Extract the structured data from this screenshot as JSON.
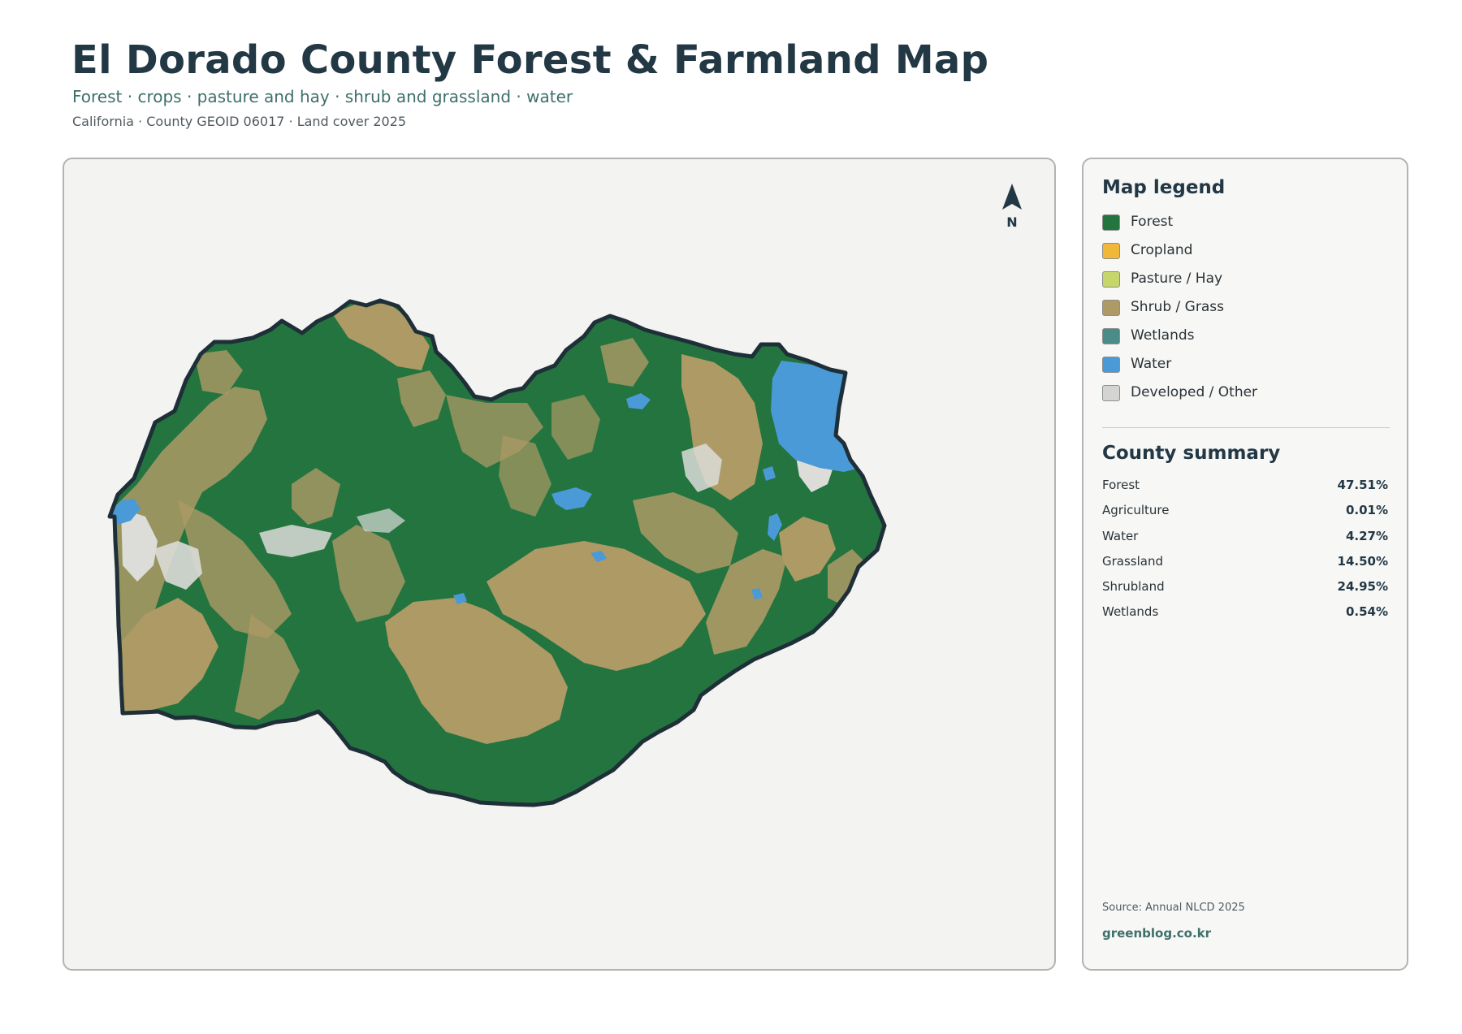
{
  "header": {
    "title": "El Dorado County Forest & Farmland Map",
    "subtitle": "Forest · crops · pasture and hay · shrub and grassland · water",
    "meta": "California · County GEOID 06017 · Land cover 2025"
  },
  "map": {
    "north_label": "N",
    "colors": {
      "background": "#f3f3f2",
      "outline": "#1f2f38",
      "forest": "#23743f",
      "shrub": "#ad9a65",
      "water": "#4a9ad8",
      "developed": "#dcdcd8"
    }
  },
  "legend": {
    "title": "Map legend",
    "items": [
      {
        "label": "Forest",
        "color": "#23743f"
      },
      {
        "label": "Cropland",
        "color": "#f0b738"
      },
      {
        "label": "Pasture / Hay",
        "color": "#c6d66b"
      },
      {
        "label": "Shrub / Grass",
        "color": "#ad9a65"
      },
      {
        "label": "Wetlands",
        "color": "#4a8c87"
      },
      {
        "label": "Water",
        "color": "#4a9ad8"
      },
      {
        "label": "Developed / Other",
        "color": "#d4d4d2"
      }
    ]
  },
  "summary": {
    "title": "County summary",
    "rows": [
      {
        "name": "Forest",
        "value": "47.51%"
      },
      {
        "name": "Agriculture",
        "value": "0.01%"
      },
      {
        "name": "Water",
        "value": "4.27%"
      },
      {
        "name": "Grassland",
        "value": "14.50%"
      },
      {
        "name": "Shrubland",
        "value": "24.95%"
      },
      {
        "name": "Wetlands",
        "value": "0.54%"
      }
    ]
  },
  "footer": {
    "source": "Source: Annual NLCD 2025",
    "credit": "greenblog.co.kr"
  }
}
